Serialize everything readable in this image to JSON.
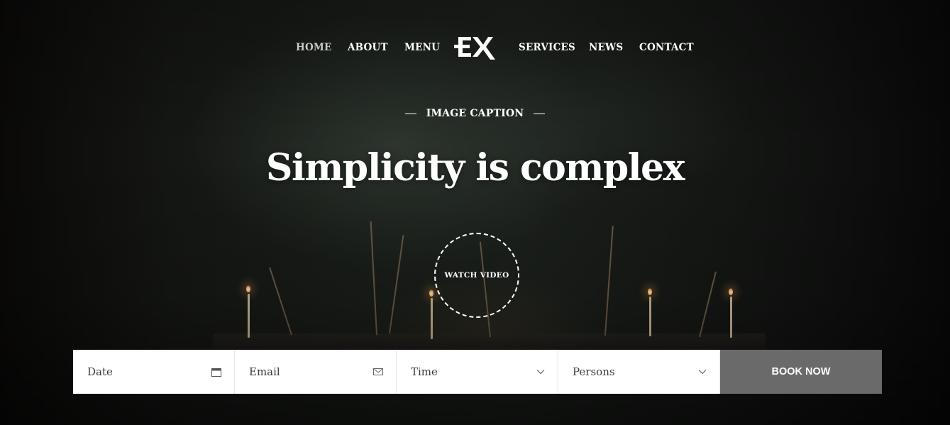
{
  "nav": {
    "items": [
      {
        "label": "HOME",
        "active": true
      },
      {
        "label": "ABOUT",
        "active": false
      },
      {
        "label": "MENU",
        "active": false
      },
      {
        "label": "SERVICES",
        "active": false
      },
      {
        "label": "NEWS",
        "active": false
      },
      {
        "label": "CONTACT",
        "active": false
      }
    ],
    "logo_text": "EX"
  },
  "hero": {
    "caption": "IMAGE CAPTION",
    "headline": "Simplicity is complex",
    "video_label": "WATCH VIDEO"
  },
  "booking": {
    "date_placeholder": "Date",
    "email_placeholder": "Email",
    "time_placeholder": "Time",
    "persons_placeholder": "Persons",
    "submit_label": "BOOK NOW"
  },
  "icons": {
    "date": "calendar-icon",
    "email": "envelope-icon",
    "time": "chevron-down-icon",
    "persons": "chevron-down-icon"
  },
  "colors": {
    "book_button": "#6a6a6a",
    "nav_active": "#c9c9c9",
    "text": "#ffffff"
  }
}
